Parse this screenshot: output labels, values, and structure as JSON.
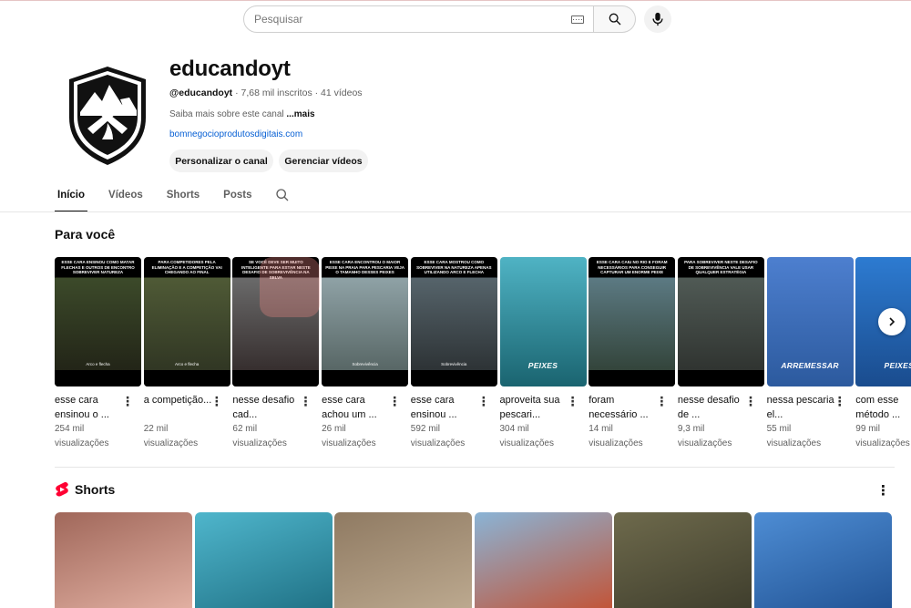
{
  "search": {
    "placeholder": "Pesquisar"
  },
  "channel": {
    "name": "educandoyt",
    "handle": "@educandoyt",
    "meta": " · 7,68 mil inscritos · 41 vídeos",
    "about": "Saiba mais sobre este canal ",
    "about_more": "...mais",
    "link": "bomnegocioprodutosdigitais.com",
    "btn_customize": "Personalizar o canal",
    "btn_manage": "Gerenciar vídeos"
  },
  "tabs": [
    "Início",
    "Vídeos",
    "Shorts",
    "Posts"
  ],
  "for_you": {
    "title": "Para você",
    "videos": [
      {
        "title": "esse cara ensinou o ...",
        "views": "254 mil visualizações",
        "caption_top": "Esse cara ensinou como matar flechas e outros de encontro sobreviver natureza",
        "caption_bottom": "Arco e flecha",
        "color1": "#3c4a2a",
        "color2": "#1e1e14"
      },
      {
        "title": "a competição...",
        "views": "22 mil visualizações",
        "caption_top": "Para competidores pela eliminação e a competição vai chegando ao final",
        "caption_bottom": "Arco e flecha",
        "color1": "#4f5a36",
        "color2": "#2b3020"
      },
      {
        "title": "nesse desafio cad...",
        "views": "62 mil visualizações",
        "caption_top": "Se você deve ser muito inteligente para estar neste desafio de sobrevivência na selva",
        "caption_bottom": "",
        "color1": "#6a6a6a",
        "color2": "#2d2424"
      },
      {
        "title": "esse cara achou um ...",
        "views": "26 mil visualizações",
        "caption_top": "Esse cara encontrou o maior peixe na praia para pescaria veja o tamanho desses peixes",
        "caption_bottom": "Sobrevivência",
        "color1": "#8fa2a6",
        "color2": "#4e5c5a"
      },
      {
        "title": "esse cara ensinou ...",
        "views": "592 mil visualizações",
        "caption_top": "Esse cara mostrou como sobreviver na natureza apenas utilizando arco e flecha",
        "caption_bottom": "Sobrevivência",
        "color1": "#56646b",
        "color2": "#262a2c"
      },
      {
        "title": "aproveita sua pescari...",
        "views": "304 mil visualizações",
        "caption_top": "",
        "caption_big": "PEIXES",
        "color1": "#4fb3c4",
        "color2": "#1a6470"
      },
      {
        "title": "foram necessário ...",
        "views": "14 mil visualizações",
        "caption_top": "Esse cara caiu no rio e foram necessários para conseguir capturar um enorme peixe",
        "caption_bottom": "",
        "color1": "#5c7a83",
        "color2": "#2c3b2e"
      },
      {
        "title": "nesse desafio de ...",
        "views": "9,3 mil visualizações",
        "caption_top": "Para sobreviver neste desafio de sobrevivência vale usar qualquer estratégia",
        "caption_bottom": "",
        "color1": "#505a55",
        "color2": "#2a2d2a"
      },
      {
        "title": "nessa pescaria el...",
        "views": "55 mil visualizações",
        "caption_top": "",
        "caption_big": "ARREMESSAR",
        "color1": "#4d7fcf",
        "color2": "#2c5a9e"
      },
      {
        "title": "com esse método ...",
        "views": "99 mil visualizações",
        "caption_top": "",
        "caption_big": "PEIXES",
        "color1": "#2d7bd1",
        "color2": "#1a4c8e"
      }
    ]
  },
  "shorts": {
    "title": "Shorts",
    "items": [
      {
        "color1": "#a0675a",
        "color2": "#e7b6a8"
      },
      {
        "color1": "#4fb6cc",
        "color2": "#1c6c80"
      },
      {
        "color1": "#8f7a62",
        "color2": "#c0ad93"
      },
      {
        "color1": "#8ab4d6",
        "color2": "#c74c2a"
      },
      {
        "color1": "#6e6a4c",
        "color2": "#3b3a2a"
      },
      {
        "color1": "#4e8dd4",
        "color2": "#1e4f90"
      }
    ]
  }
}
